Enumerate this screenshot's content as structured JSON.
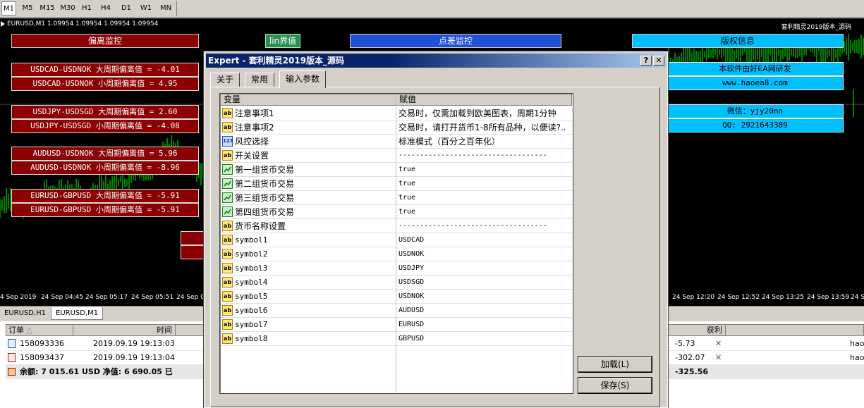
{
  "toolbar": {
    "timeframes": [
      "M1",
      "M5",
      "M15",
      "M30",
      "H1",
      "H4",
      "D1",
      "W1",
      "MN"
    ]
  },
  "chart": {
    "info": "EURUSD,M1  1.09954 1.09954 1.09954 1.09954",
    "ea_name": "套利精灵2019版本_源码",
    "time_labels": [
      "4 Sep 2019",
      "24 Sep 04:45",
      "24 Sep 05:17",
      "24 Sep 05:51",
      "24 Sep 0",
      "24 Sep 12:20",
      "24 Sep 12:52",
      "24 Sep 13:25",
      "24 Sep 13:59",
      "24 S"
    ],
    "colors": {
      "candle": "#00ff00",
      "level_line": "#505050"
    }
  },
  "header_buttons": {
    "deviation": "偏离监控",
    "line": "lin界值",
    "spread": "点差监控",
    "copyright": "版权信息"
  },
  "deviation_labels": [
    "USDCAD-USDNOK 大周期偏离值 = -4.01",
    "USDCAD-USDNOK 小周期偏离值 = 4.95",
    "USDJPY-USDSGD 大周期偏离值 = 2.60",
    "USDJPY-USDSGD 小周期偏离值 = -4.08",
    "AUDUSD-USDNOK 大周期偏离值 = 5.96",
    "AUDUSD-USDNOK 小周期偏离值 = -8.96",
    "EURUSD-GBPUSD 大周期偏离值 = -5.91",
    "EURUSD-GBPUSD 小周期偏离值 = -5.91"
  ],
  "info_labels": {
    "dev": "本软件由好EA网研发",
    "site": "www.haoea8.com",
    "wechat": "微信：yjy20nn",
    "qq": "QQ: 2921643389"
  },
  "chart_tabs": [
    "EURUSD,H1",
    "EURUSD,M1"
  ],
  "terminal": {
    "headers": {
      "order": "订单",
      "time": "时间",
      "profit": "获利"
    },
    "rows": [
      {
        "order": "158093336",
        "time": "2019.09.19 19:13:03",
        "profit": "-5.73",
        "close": "✕",
        "comment": "hao"
      },
      {
        "order": "158093437",
        "time": "2019.09.19 19:13:04",
        "profit": "-302.07",
        "close": "✕",
        "comment": "hao"
      }
    ],
    "balance": "余额: 7 015.61 USD  净值: 6 690.05  已",
    "balance_profit": "-325.56"
  },
  "dialog": {
    "title": "Expert - 套利精灵2019版本_源码",
    "help": "?",
    "close": "✕",
    "tabs": [
      "关于",
      "常用",
      "输入参数"
    ],
    "grid_headers": {
      "variable": "变量",
      "value": "赋值"
    },
    "rows": [
      {
        "icon": "ab",
        "name": "注意事项1",
        "value": "交易时，仅需加载到欧美图表，周期1分钟"
      },
      {
        "icon": "ab",
        "name": "注意事项2",
        "value": "交易时，请打开货币1-8所有品种，以便读?.."
      },
      {
        "icon": "123",
        "name": "风控选择",
        "value": "标准模式（百分之百年化）"
      },
      {
        "icon": "ab",
        "name": "开关设置",
        "value": "-----------------------------------"
      },
      {
        "icon": "bool",
        "name": "第一组货币交易",
        "value": "true"
      },
      {
        "icon": "bool",
        "name": "第二组货币交易",
        "value": "true"
      },
      {
        "icon": "bool",
        "name": "第三组货币交易",
        "value": "true"
      },
      {
        "icon": "bool",
        "name": "第四组货币交易",
        "value": "true"
      },
      {
        "icon": "ab",
        "name": "货币名称设置",
        "value": "-----------------------------------"
      },
      {
        "icon": "ab",
        "name": "symbol1",
        "value": "USDCAD"
      },
      {
        "icon": "ab",
        "name": "symbol2",
        "value": "USDNOK"
      },
      {
        "icon": "ab",
        "name": "symbol3",
        "value": "USDJPY"
      },
      {
        "icon": "ab",
        "name": "symbol4",
        "value": "USDSGD"
      },
      {
        "icon": "ab",
        "name": "symbol5",
        "value": "USDNOK"
      },
      {
        "icon": "ab",
        "name": "symbol6",
        "value": "AUDUSD"
      },
      {
        "icon": "ab",
        "name": "symbol7",
        "value": "EURUSD"
      },
      {
        "icon": "ab",
        "name": "symbol8",
        "value": "GBPUSD"
      }
    ],
    "buttons": {
      "load": "加载(L)",
      "save": "保存(S)"
    }
  }
}
